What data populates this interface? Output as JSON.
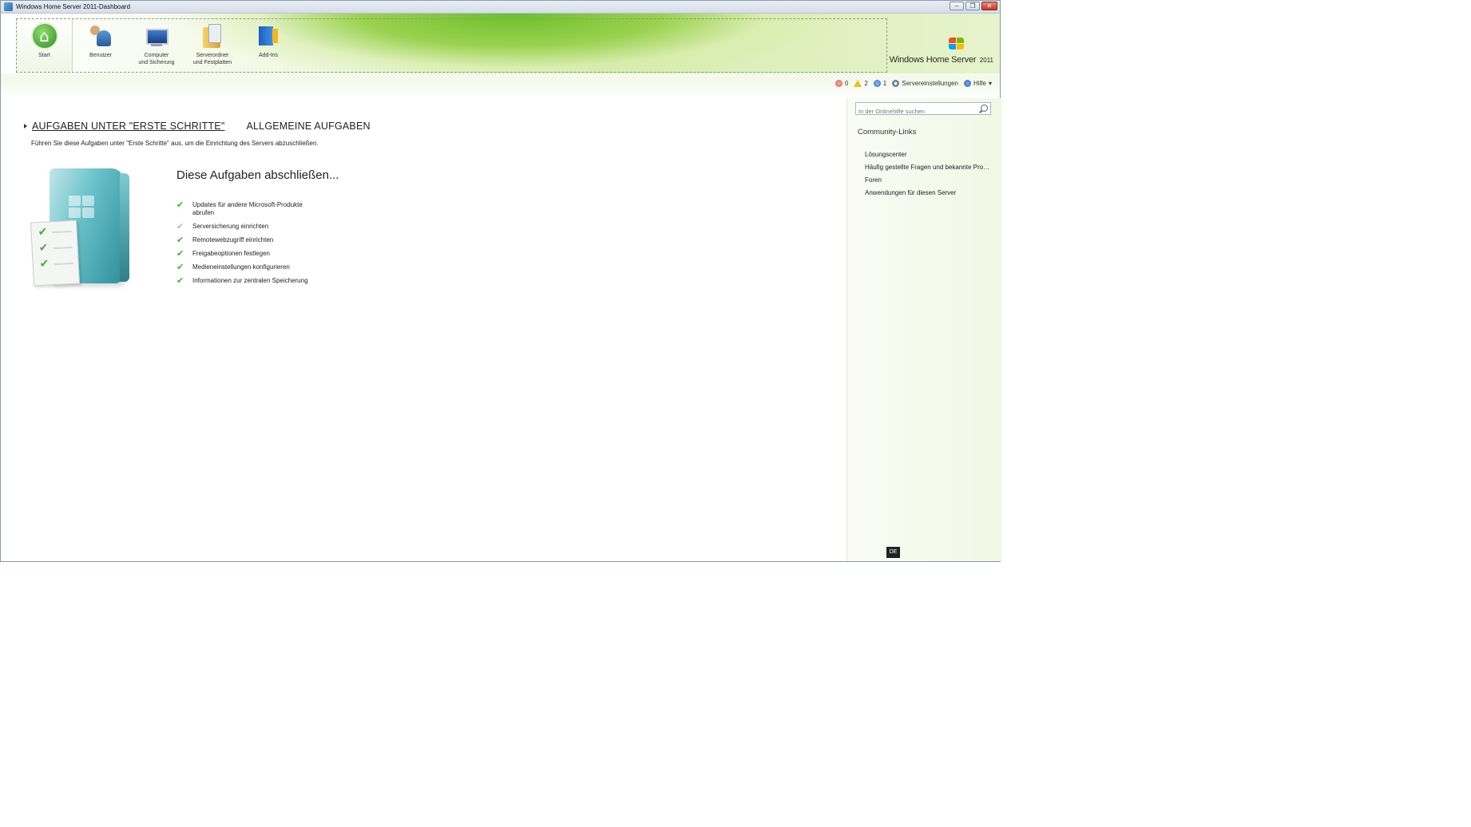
{
  "window": {
    "title": "Windows Home Server 2011-Dashboard",
    "buttons": {
      "minimize": "–",
      "restore": "❐",
      "close": "✕"
    }
  },
  "nav": {
    "items": [
      {
        "label": "Start",
        "icon": "home-icon"
      },
      {
        "label": "Benutzer",
        "icon": "users-icon"
      },
      {
        "label_line1": "Computer",
        "label_line2": "und Sicherung",
        "icon": "computer-icon"
      },
      {
        "label_line1": "Serverordner",
        "label_line2": "und Festplatten",
        "icon": "folder-icon"
      },
      {
        "label": "Add-Ins",
        "icon": "addins-icon"
      }
    ]
  },
  "brand": {
    "name": "Windows Home Server",
    "year": "2011"
  },
  "status": {
    "errors": "0",
    "warnings": "2",
    "info": "1",
    "settings_label": "Servereinstellungen",
    "help_label": "Hilfe",
    "help_arrow": "▾"
  },
  "main": {
    "tabs": [
      {
        "label": "AUFGABEN UNTER \"ERSTE SCHRITTE\""
      },
      {
        "label": "ALLGEMEINE AUFGABEN"
      }
    ],
    "subtitle": "Führen Sie diese Aufgaben unter \"Erste Schritte\" aus, um die Einrichtung des Servers abzuschließen.",
    "tasks_heading": "Diese Aufgaben abschließen...",
    "tasks": [
      {
        "text": "Updates für andere Microsoft-Produkte abrufen",
        "done": true
      },
      {
        "text": "Serversicherung einrichten",
        "done": false
      },
      {
        "text": "Remotewebzugriff einrichten",
        "done": true
      },
      {
        "text": "Freigabeoptionen festlegen",
        "done": true
      },
      {
        "text": "Medieneinstellungen konfigurieren",
        "done": true
      },
      {
        "text": "Informationen zur zentralen Speicherung",
        "done": true
      }
    ],
    "check_glyph": "✔"
  },
  "sidebar": {
    "search_placeholder": "In der Onlinehilfe suchen",
    "heading": "Community-Links",
    "links": [
      "Lösungscenter",
      "Häufig gestellte Fragen und bekannte Probleme",
      "Foren",
      "Anwendungen für diesen Server"
    ],
    "language": "DE"
  },
  "colors": {
    "accent_green": "#6cbf2a",
    "check_green": "#4caa3a",
    "box_teal": "#66c0c8"
  }
}
